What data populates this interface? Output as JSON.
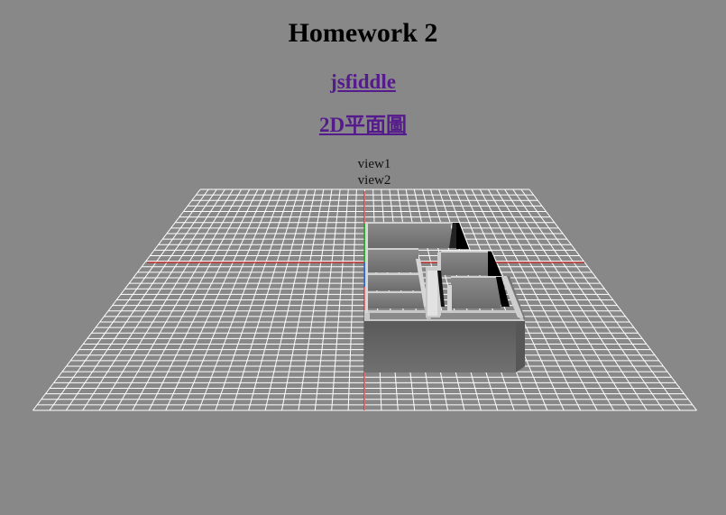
{
  "page": {
    "title": "Homework 2"
  },
  "links": {
    "jsfiddle": "jsfiddle",
    "floorplan_2d": "2D平面圖"
  },
  "view_controls": {
    "view1": "view1",
    "view2": "view2"
  },
  "scene": {
    "background_color": "#888888",
    "grid_color": "#ffffff",
    "axis_x_color": "#cc2222",
    "axis_y_color": "#33aa33",
    "axis_z_color": "#3366cc",
    "wall_color": "#666666"
  }
}
